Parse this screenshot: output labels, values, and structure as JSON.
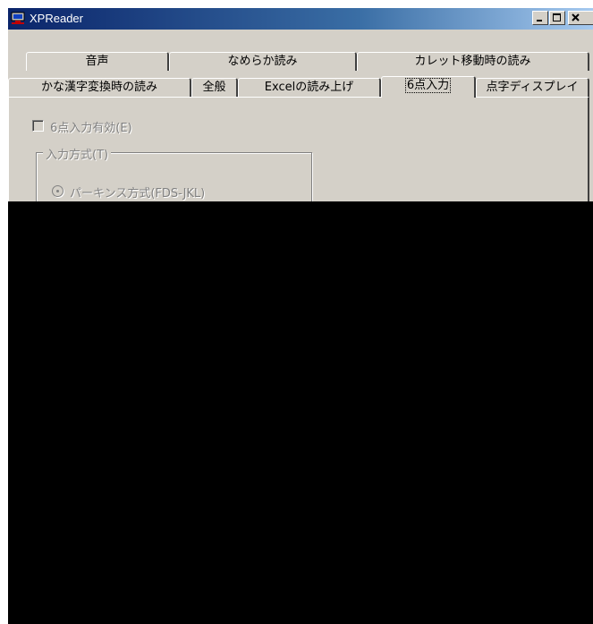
{
  "window": {
    "title": "XPReader",
    "icon": "monitor-app-icon",
    "controls": [
      "minimize-icon",
      "maximize-icon",
      "close-icon"
    ]
  },
  "tabs": {
    "row1": [
      "音声",
      "なめらか読み",
      "カレット移動時の読み"
    ],
    "row2": [
      "かな漢字変換時の読み",
      "全般",
      "Excelの読み上げ",
      "6点入力",
      "点字ディスプレイ"
    ],
    "active": "6点入力"
  },
  "panel": {
    "enable_checkbox_label": "6点入力有効(E)",
    "enable_checked": false,
    "group_label": "入力方式(T)",
    "radio_label": "パーキンス方式(FDS-JKL)",
    "radio_selected": true
  },
  "colors": {
    "titlebar_start": "#0a246a",
    "titlebar_end": "#a6caf0",
    "face": "#d4d0c8",
    "disabled_text": "#808080"
  }
}
